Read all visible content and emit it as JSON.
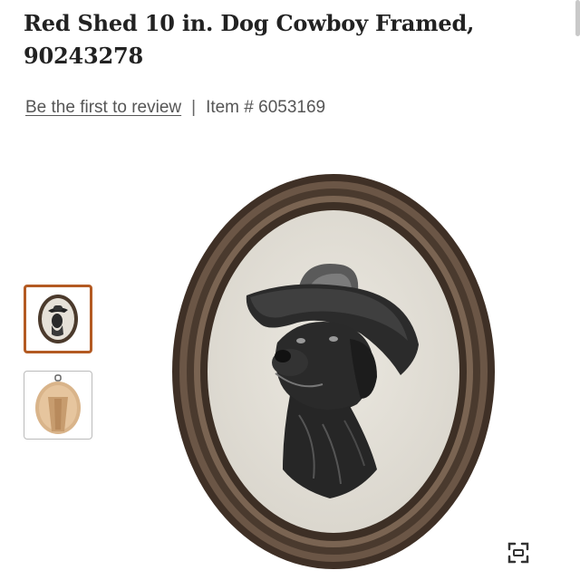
{
  "product": {
    "title": "Red Shed 10 in. Dog Cowboy Framed, 90243278",
    "review_link": "Be the first to review",
    "separator": "|",
    "item_number": "Item # 6053169"
  },
  "gallery": {
    "thumbnails": [
      {
        "icon": "framed-dog-portrait-thumbnail",
        "selected": true
      },
      {
        "icon": "frame-back-stand-thumbnail",
        "selected": false
      }
    ],
    "main_image": "oval-framed-dog-in-cowboy-hat",
    "zoom_icon": "fullscreen-zoom-icon"
  },
  "colors": {
    "selected_border": "#b35a22",
    "frame": "#4a3a2e"
  }
}
